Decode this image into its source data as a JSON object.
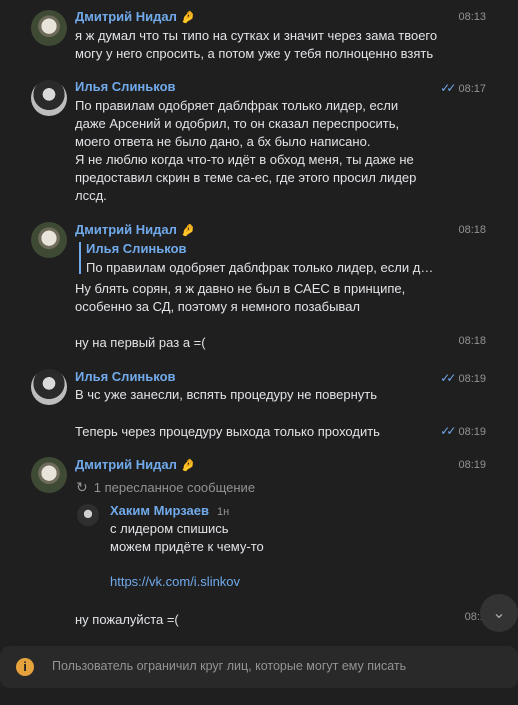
{
  "messages": [
    {
      "author": "Дмитрий Нидал",
      "emoji": "🤌",
      "time": "08:13",
      "text": "я ж думал что ты типо на сутках и значит через зама твоего\nмогу у него спросить, а потом уже у тебя полноценно взять"
    },
    {
      "author": "Илья Слиньков",
      "time": "08:17",
      "read": true,
      "text": "По правилам одобряет даблфрак только лидер, если\nдаже Арсений и одобрил, то он сказал переспросить,\nмоего ответа не было дано, а бх было написано.\nЯ не люблю когда что-то идёт в обход меня, ты даже не\nпредоставил скрин в теме са-ес, где этого просил лидер\nлссд."
    },
    {
      "author": "Дмитрий Нидал",
      "emoji": "🤌",
      "time": "08:18",
      "reply": {
        "author": "Илья Слиньков",
        "text": "По правилам одобряет даблфрак только лидер, если да..."
      },
      "text": "Ну блять сорян, я ж давно не был в САЕС в принципе,\nособенно за СД, поэтому я немного позабывал",
      "followup": {
        "text": "ну на первый раз а =(",
        "time": "08:18"
      }
    },
    {
      "author": "Илья Слиньков",
      "time": "08:19",
      "read": true,
      "text": "В чс уже занесли, вспять процедуру не повернуть",
      "followup": {
        "text": "Теперь через процедуру выхода только проходить",
        "time": "08:19",
        "read": true
      }
    },
    {
      "author": "Дмитрий Нидал",
      "emoji": "🤌",
      "time": "08:19",
      "forward_label": "1 пересланное сообщение",
      "forwarded": {
        "author": "Хаким Мирзаев",
        "time": "1н",
        "text": "с лидером спишись\nможем придёте к чему-то",
        "link": "https://vk.com/i.slinkov"
      },
      "followup": {
        "text": "ну пожалуйста =(",
        "time": "08:1"
      }
    }
  ],
  "notice": {
    "text": "Пользователь ограничил круг лиц, которые могут ему писать",
    "icon": "info-icon"
  },
  "icons": {
    "read": "double-check-icon",
    "scroll": "chevron-down-icon",
    "forward": "forward-arrow-icon"
  },
  "colors": {
    "accent": "#71aaeb",
    "background": "#1f1f20",
    "warning": "#e6a23c"
  }
}
